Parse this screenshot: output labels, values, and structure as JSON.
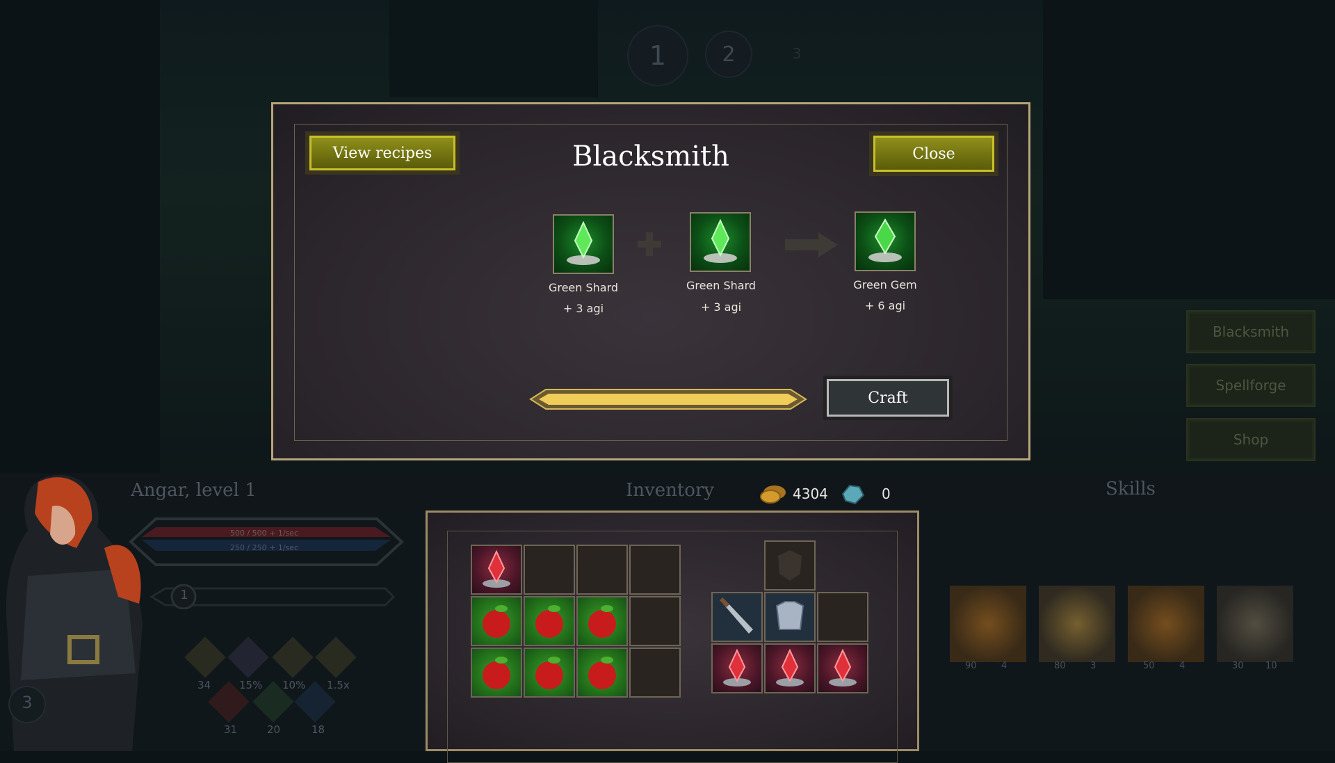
{
  "stages": [
    "1",
    "2",
    "3"
  ],
  "side_menu": {
    "blacksmith": "Blacksmith",
    "spellforge": "Spellforge",
    "shop": "Shop"
  },
  "modal": {
    "title": "Blacksmith",
    "view_recipes": "View recipes",
    "close": "Close",
    "craft": "Craft",
    "ingredient1": {
      "name": "Green Shard",
      "stat": "+ 3 agi"
    },
    "ingredient2": {
      "name": "Green Shard",
      "stat": "+ 3 agi"
    },
    "result": {
      "name": "Green Gem",
      "stat": "+ 6 agi"
    }
  },
  "hero": {
    "name": "Angar, level 1",
    "hp": "500 / 500 + 1/sec",
    "mana": "250 / 250 + 1/sec",
    "xp_level": "1",
    "portrait_level": "3",
    "stats_row1": [
      "34",
      "15%",
      "10%",
      "1.5x"
    ],
    "stats_row2": [
      "31",
      "20",
      "18"
    ]
  },
  "inventory": {
    "label": "Inventory",
    "gold": "4304",
    "gems": "0"
  },
  "skills": {
    "label": "Skills",
    "items": [
      {
        "a": "90",
        "b": "4"
      },
      {
        "a": "80",
        "b": "3"
      },
      {
        "a": "50",
        "b": "4"
      },
      {
        "a": "30",
        "b": "10"
      }
    ]
  },
  "colors": {
    "gold_button": "#7a7b12",
    "modal_border": "#b9a57a",
    "background": "#0d1418"
  }
}
